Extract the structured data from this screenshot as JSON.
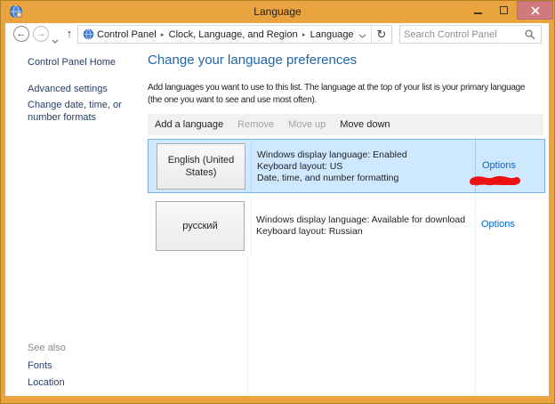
{
  "window": {
    "title": "Language"
  },
  "icons": {
    "back": "←",
    "forward": "→",
    "up": "↑",
    "refresh": "↻"
  },
  "address_bar": {
    "breadcrumb": [
      "Control Panel",
      "Clock, Language, and Region",
      "Language"
    ],
    "search_placeholder": "Search Control Panel"
  },
  "sidebar": {
    "home": "Control Panel Home",
    "links": [
      "Advanced settings",
      "Change date, time, or number formats"
    ],
    "see_also": {
      "header": "See also",
      "links": [
        "Fonts",
        "Location"
      ]
    }
  },
  "main": {
    "heading": "Change your language preferences",
    "description_lines": [
      "Add languages you want to use to this list. The language at the top of your list is your primary language",
      "(the one you want to see and use most often)."
    ],
    "toolbar": {
      "add": "Add a language",
      "remove": "Remove",
      "move_up": "Move up",
      "move_down": "Move down"
    },
    "languages": [
      {
        "name": "English (United States)",
        "details": [
          "Windows display language: Enabled",
          "Keyboard layout: US",
          "Date, time, and number formatting"
        ],
        "options": "Options",
        "selected": true
      },
      {
        "name": "русский",
        "details": [
          "Windows display language: Available for download",
          "Keyboard layout: Russian"
        ],
        "options": "Options",
        "selected": false
      }
    ]
  },
  "colors": {
    "titlebar": "#e9a43f",
    "close_button": "#d17a7e",
    "selection_bg": "#cde8ff",
    "selection_border": "#7eb0e3",
    "heading": "#2166ac",
    "options_link": "#0066cc",
    "sidebar_link": "#243e66",
    "annotation": "#ee1111"
  }
}
